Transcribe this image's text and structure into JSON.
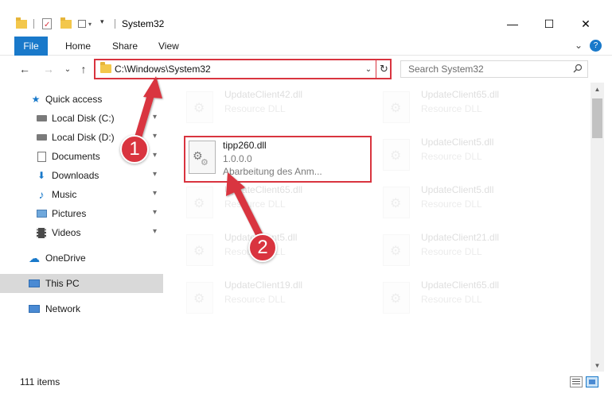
{
  "window": {
    "title": "System32",
    "minimize_glyph": "—",
    "maximize_glyph": "☐",
    "close_glyph": "✕"
  },
  "ribbon": {
    "tabs": [
      "File",
      "Home",
      "Share",
      "View"
    ],
    "collapse_glyph": "⌄",
    "help_glyph": "?"
  },
  "address": {
    "path": "C:\\Windows\\System32",
    "search_placeholder": "Search System32",
    "refresh_glyph": "↻",
    "dropdown_glyph": "⌄"
  },
  "nav": {
    "back_glyph": "←",
    "forward_glyph": "→",
    "recent_glyph": "⌄",
    "up_glyph": "↑"
  },
  "sidebar": {
    "items": [
      {
        "label": "Quick access",
        "icon": "star-icon",
        "glyph": "★",
        "color": "#1979ca"
      },
      {
        "label": "Local Disk (C:)",
        "icon": "drive-icon",
        "glyph": "▬",
        "color": "#555555",
        "pinned": true
      },
      {
        "label": "Local Disk (D:)",
        "icon": "drive-icon",
        "glyph": "▬",
        "color": "#555555",
        "pinned": true
      },
      {
        "label": "Documents",
        "icon": "documents-icon",
        "glyph": "▤",
        "color": "#6d6d6d",
        "pinned": true
      },
      {
        "label": "Downloads",
        "icon": "downloads-icon",
        "glyph": "⬇",
        "color": "#1979ca",
        "pinned": true
      },
      {
        "label": "Music",
        "icon": "music-icon",
        "glyph": "♪",
        "color": "#1979ca",
        "pinned": true
      },
      {
        "label": "Pictures",
        "icon": "pictures-icon",
        "glyph": "▣",
        "color": "#4a8ad3",
        "pinned": true
      },
      {
        "label": "Videos",
        "icon": "videos-icon",
        "glyph": "▦",
        "color": "#4a4a4a",
        "pinned": true
      },
      {
        "label": "OneDrive",
        "icon": "onedrive-icon",
        "glyph": "☁",
        "color": "#1979ca"
      },
      {
        "label": "This PC",
        "icon": "computer-icon",
        "glyph": "▭",
        "color": "#1979ca",
        "selected": true
      },
      {
        "label": "Network",
        "icon": "network-icon",
        "glyph": "⊞",
        "color": "#1979ca"
      }
    ],
    "pin_glyph": "📌"
  },
  "files": {
    "highlighted": {
      "name": "tipp260.dll",
      "version": "1.0.0.0",
      "description": "Abarbeitung des Anm..."
    },
    "faded": [
      {
        "name": "UpdateClient42.dll",
        "sub": "Resource DLL"
      },
      {
        "name": "UpdateClient65.dll",
        "sub": "Resource DLL"
      },
      {
        "name": "UpdateClient5.dll",
        "sub": "Resource DLL"
      },
      {
        "name": "UpdateClient65.dll",
        "sub": "Resource DLL"
      },
      {
        "name": "UpdateClient5.dll",
        "sub": "Resource DLL"
      },
      {
        "name": "UpdateClient5.dll",
        "sub": "Resource DLL"
      },
      {
        "name": "UpdateClient21.dll",
        "sub": "Resource DLL"
      },
      {
        "name": "UpdateClient19.dll",
        "sub": "Resource DLL"
      },
      {
        "name": "UpdateClient65.dll",
        "sub": "Resource DLL"
      }
    ],
    "gear_glyph": "⚙"
  },
  "status": {
    "item_count": "111 items"
  },
  "annotations": {
    "badge_1": "1",
    "badge_2": "2",
    "color": "#d9343f"
  },
  "colors": {
    "accent": "#1979ca",
    "highlight_red": "#d9343f",
    "selected_bg": "#d9d9d9"
  }
}
